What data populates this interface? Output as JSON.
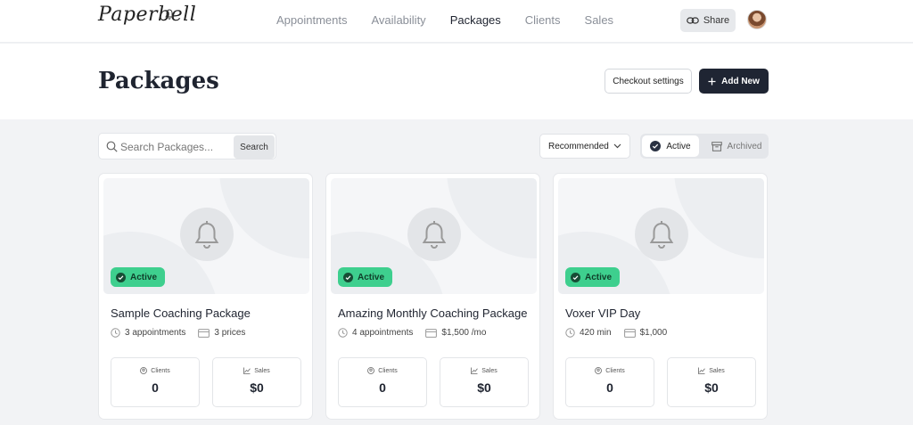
{
  "brand": {
    "logo_text": "Paperbell"
  },
  "nav": {
    "items": [
      "Appointments",
      "Availability",
      "Packages",
      "Clients",
      "Sales"
    ],
    "active": "Packages"
  },
  "topbar": {
    "share_label": "Share"
  },
  "header": {
    "title": "Packages",
    "checkout_label": "Checkout settings",
    "add_label": "Add New"
  },
  "toolbar": {
    "search_placeholder": "Search Packages...",
    "search_button": "Search",
    "sort_value": "Recommended",
    "filter_active": "Active",
    "filter_archived": "Archived"
  },
  "packages": [
    {
      "title": "Sample Coaching Package",
      "badge": "Active",
      "meta1": "3 appointments",
      "meta2": "3 prices",
      "clients_label": "Clients",
      "clients": "0",
      "sales_label": "Sales",
      "sales": "$0"
    },
    {
      "title": "Amazing Monthly Coaching Package",
      "badge": "Active",
      "meta1": "4 appointments",
      "meta2": "$1,500 /mo",
      "clients_label": "Clients",
      "clients": "0",
      "sales_label": "Sales",
      "sales": "$0"
    },
    {
      "title": "Voxer VIP Day",
      "badge": "Active",
      "meta1": "420 min",
      "meta2": "$1,000",
      "clients_label": "Clients",
      "clients": "0",
      "sales_label": "Sales",
      "sales": "$0"
    }
  ],
  "colors": {
    "accent_dark": "#1f2533",
    "active_badge": "#3ecf8e"
  }
}
